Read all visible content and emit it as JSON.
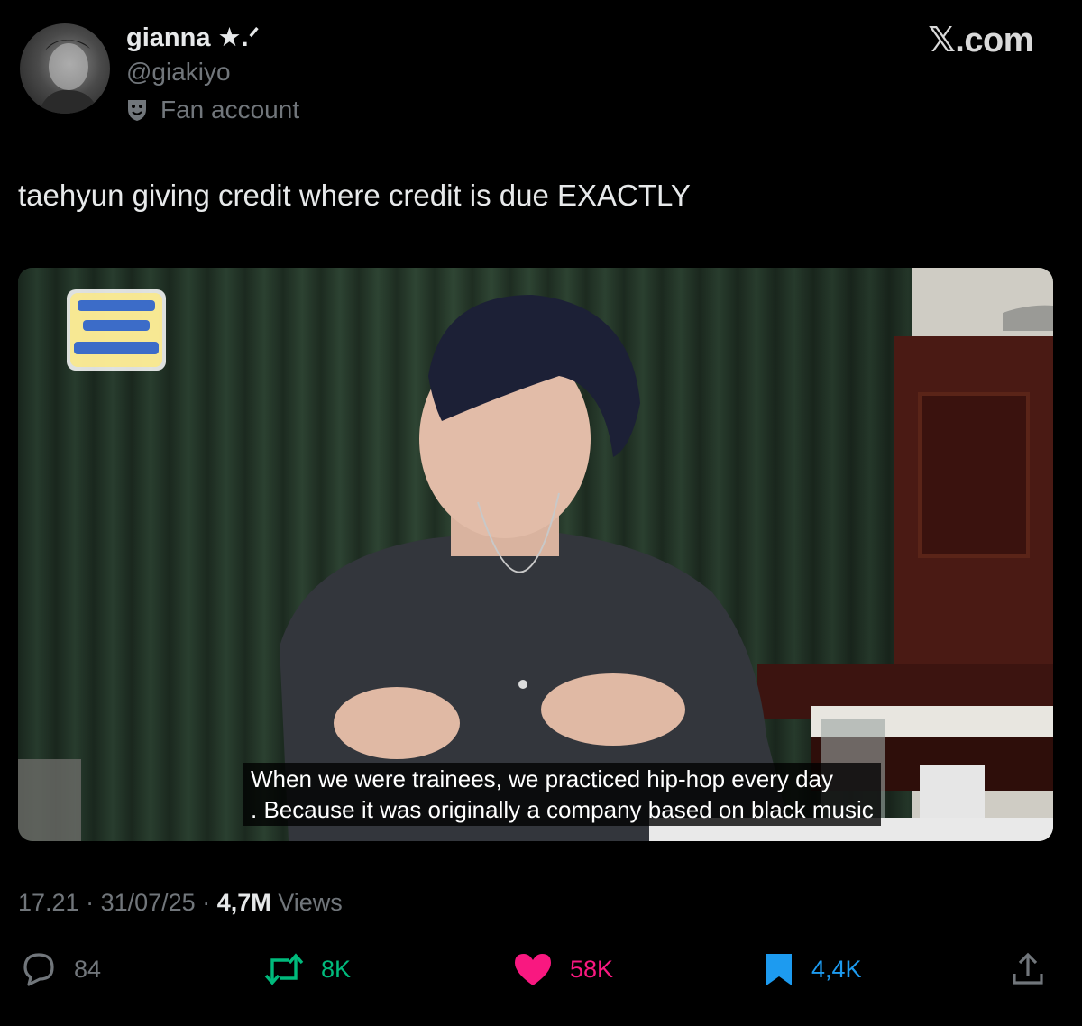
{
  "author": {
    "display_name": "gianna ★.ᐟ",
    "handle": "@giakiyo",
    "label": "Fan account",
    "label_icon": "theater-masks-icon"
  },
  "brand": "𝕏.com",
  "tweet": {
    "text": "taehyun giving credit where credit is due EXACTLY"
  },
  "media": {
    "subtitle_line1": "When we were trainees, we practiced hip-hop every day",
    "subtitle_line2": ".  Because it was originally a company based on black music"
  },
  "meta": {
    "time": "17.21",
    "separator": " · ",
    "date": "31/07/25",
    "views_count": "4,7M",
    "views_label": "Views"
  },
  "actions": {
    "replies": "84",
    "retweets": "8K",
    "likes": "58K",
    "bookmarks": "4,4K"
  },
  "colors": {
    "background": "#000000",
    "muted": "#71767b",
    "retweet": "#00ba7c",
    "like": "#f91880",
    "bookmark": "#1d9bf0"
  }
}
